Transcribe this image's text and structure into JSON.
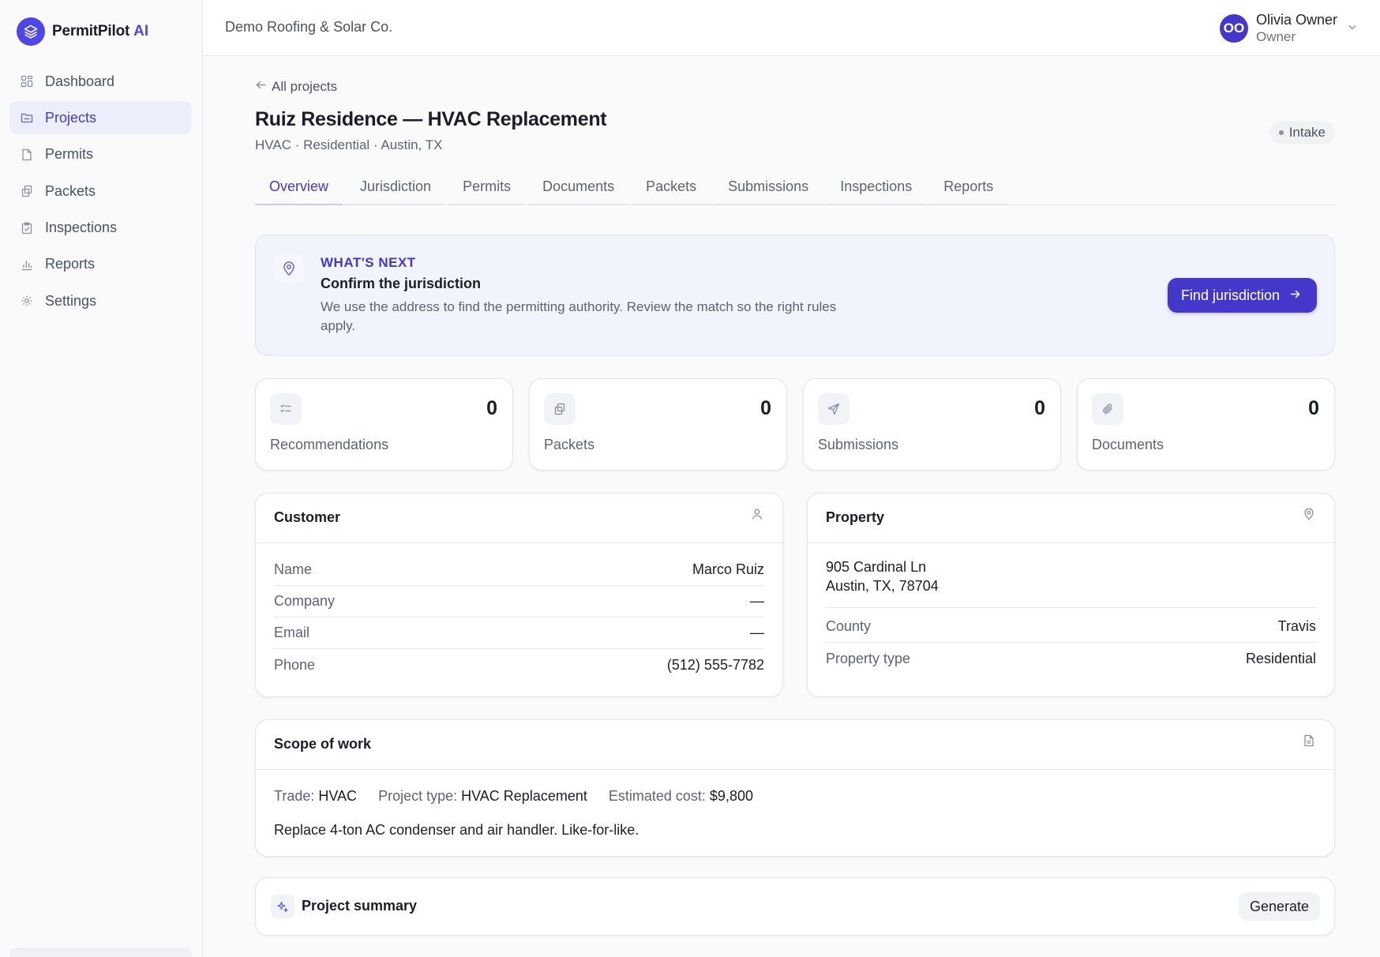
{
  "brand": {
    "name": "PermitPilot",
    "suffix": "AI"
  },
  "sidebar": {
    "items": [
      {
        "label": "Dashboard",
        "icon": "dashboard-icon"
      },
      {
        "label": "Projects",
        "icon": "folder-icon",
        "active": true
      },
      {
        "label": "Permits",
        "icon": "file-icon"
      },
      {
        "label": "Packets",
        "icon": "packets-icon"
      },
      {
        "label": "Inspections",
        "icon": "clipboard-icon"
      },
      {
        "label": "Reports",
        "icon": "bar-chart-icon"
      },
      {
        "label": "Settings",
        "icon": "gear-icon"
      }
    ]
  },
  "header": {
    "org_name": "Demo Roofing & Solar Co.",
    "user": {
      "initials": "OO",
      "name": "Olivia Owner",
      "role": "Owner"
    }
  },
  "project": {
    "back_label": "All projects",
    "title": "Ruiz Residence — HVAC Replacement",
    "subtitle": "HVAC · Residential · Austin, TX",
    "status": "Intake"
  },
  "tabs": [
    "Overview",
    "Jurisdiction",
    "Permits",
    "Documents",
    "Packets",
    "Submissions",
    "Inspections",
    "Reports"
  ],
  "active_tab": "Overview",
  "next_step": {
    "kicker": "WHAT'S NEXT",
    "title": "Confirm the jurisdiction",
    "description": "We use the address to find the permitting authority. Review the match so the right rules apply.",
    "button_label": "Find jurisdiction"
  },
  "stats": [
    {
      "label": "Recommendations",
      "value": "0",
      "icon": "checklist-icon"
    },
    {
      "label": "Packets",
      "value": "0",
      "icon": "packets-icon"
    },
    {
      "label": "Submissions",
      "value": "0",
      "icon": "send-icon"
    },
    {
      "label": "Documents",
      "value": "0",
      "icon": "paperclip-icon"
    }
  ],
  "customer": {
    "title": "Customer",
    "fields": [
      {
        "label": "Name",
        "value": "Marco Ruiz"
      },
      {
        "label": "Company",
        "value": "—"
      },
      {
        "label": "Email",
        "value": "—"
      },
      {
        "label": "Phone",
        "value": "(512) 555-7782"
      }
    ]
  },
  "property": {
    "title": "Property",
    "address_line1": "905 Cardinal Ln",
    "address_line2": "Austin, TX, 78704",
    "fields": [
      {
        "label": "County",
        "value": "Travis"
      },
      {
        "label": "Property type",
        "value": "Residential"
      }
    ]
  },
  "scope": {
    "title": "Scope of work",
    "trade_label": "Trade:",
    "trade": "HVAC",
    "project_type_label": "Project type:",
    "project_type": "HVAC Replacement",
    "cost_label": "Estimated cost:",
    "cost": "$9,800",
    "description": "Replace 4-ton AC condenser and air handler. Like-for-like."
  },
  "summary": {
    "title": "Project summary",
    "button_label": "Generate"
  },
  "colors": {
    "accent": "#4338ca",
    "banner_bg": "#f1f3fd"
  }
}
